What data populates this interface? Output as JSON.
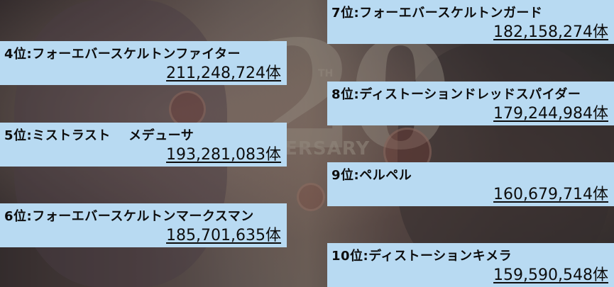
{
  "rankings": [
    {
      "label": "4位:フォーエバースケルトンファイター",
      "count": "211,248,724体"
    },
    {
      "label": "5位:ミストラスト　 メデューサ",
      "count": "193,281,083体"
    },
    {
      "label": "6位:フォーエバースケルトンマークスマン",
      "count": "185,701,635体"
    },
    {
      "label": "7位:フォーエバースケルトンガード",
      "count": "182,158,274体"
    },
    {
      "label": "8位:ディストーションドレッドスパイダー",
      "count": "179,244,984体"
    },
    {
      "label": "9位:ペルペル",
      "count": "160,679,714体"
    },
    {
      "label": "10位:ディストーションキメラ",
      "count": "159,590,548体"
    }
  ],
  "background": {
    "emblem_number": "20",
    "emblem_suffix": "TH",
    "emblem_word": "VERSARY"
  },
  "colors": {
    "panel": "#b8daf2",
    "text": "#0d0d0d"
  }
}
